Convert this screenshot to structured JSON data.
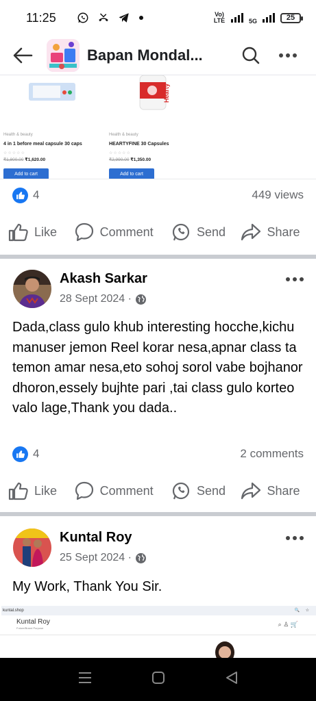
{
  "status_bar": {
    "time": "11:25",
    "volte_top": "Vo)",
    "volte_bottom": "LTE",
    "net": "5G",
    "battery": "25"
  },
  "header": {
    "title": "Bapan Mondal..."
  },
  "products": [
    {
      "category": "Health & beauty",
      "name": "4 in 1 before meal capsule 30 caps",
      "old_price": "₹1,800.00",
      "price": "₹1,620.00",
      "cta": "Add to cart"
    },
    {
      "category": "Health & beauty",
      "name": "HEARTYFINE 30 Capsules",
      "old_price": "₹2,990.00",
      "price": "₹1,350.00",
      "cta": "Add to cart",
      "brand": "Hearty"
    }
  ],
  "post": {
    "likes": "4",
    "views": "449 views"
  },
  "actions": {
    "like": "Like",
    "comment": "Comment",
    "send": "Send",
    "share": "Share"
  },
  "comments": [
    {
      "name": "Akash Sarkar",
      "date": "28 Sept 2024 ·",
      "text": "Dada,class gulo khub interesting hocche,kichu manuser jemon Reel korar nesa,apnar class ta temon amar nesa,eto sohoj sorol vabe bojhanor dhoron,essely bujhte pari ,tai class gulo korteo valo lage,Thank you dada..",
      "likes": "4",
      "comments": "2 comments"
    },
    {
      "name": "Kuntal Roy",
      "date": "25 Sept 2024 ·",
      "text": "My Work, Thank You Sir.",
      "site_url": "kuntal.shop",
      "site_title": "Kuntal Roy",
      "site_sub": "Future/Brand Purpose"
    }
  ],
  "colors": {
    "accent": "#1877f2",
    "divider": "#c9ccd1",
    "muted_text": "#65676b",
    "cart_button": "#2d6ed1"
  }
}
